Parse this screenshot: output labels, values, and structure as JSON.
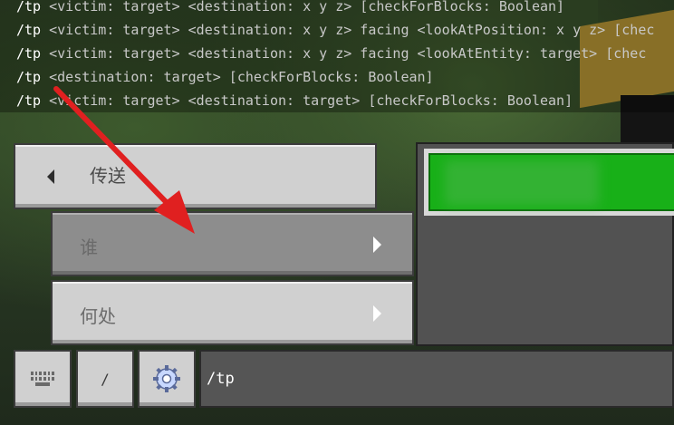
{
  "chat": [
    {
      "cmd": "/tp",
      "args": " <victim: target> <destination: x y z> [checkForBlocks: Boolean]"
    },
    {
      "cmd": "/tp",
      "args": " <victim: target> <destination: x y z> facing <lookAtPosition: x y z> [chec"
    },
    {
      "cmd": "/tp",
      "args": " <victim: target> <destination: x y z> facing <lookAtEntity: target> [chec"
    },
    {
      "cmd": "/tp",
      "args": " <destination: target> [checkForBlocks: Boolean]"
    },
    {
      "cmd": "/tp",
      "args": " <victim: target> <destination: target> [checkForBlocks: Boolean]"
    }
  ],
  "menu": {
    "teleport_label": "传送",
    "who_label": "谁",
    "where_label": "何处"
  },
  "toolbar": {
    "slash_label": "/"
  },
  "input": {
    "value": "/tp"
  },
  "colors": {
    "accent_green": "#18b018",
    "annotation_red": "#e02020"
  },
  "icons": {
    "keyboard": "keyboard-icon",
    "settings": "gear-icon",
    "back": "chevron-left-icon",
    "forward": "chevron-right-icon"
  }
}
